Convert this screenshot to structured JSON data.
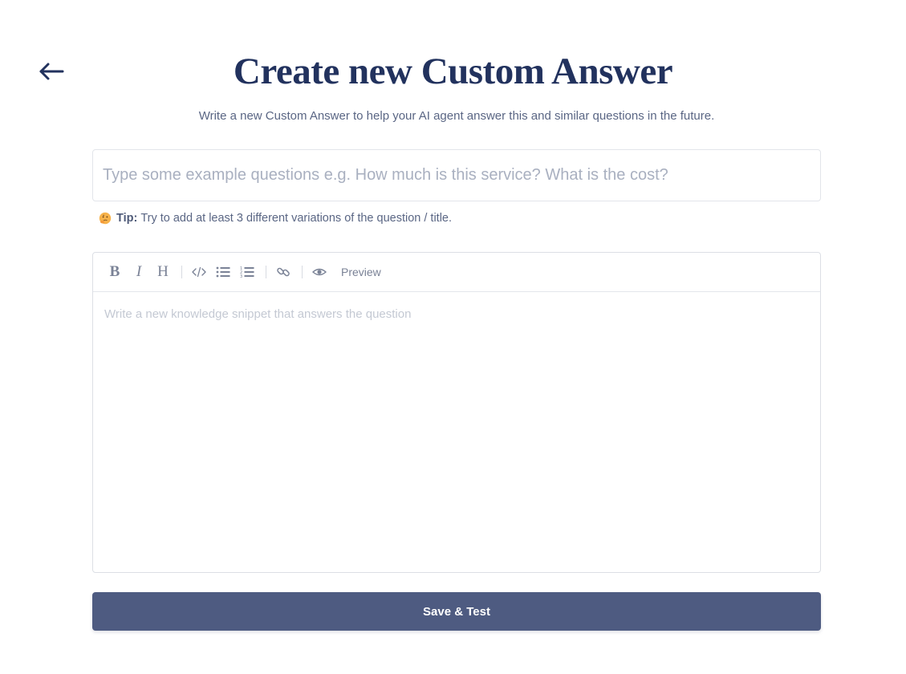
{
  "header": {
    "back_icon": "arrow-left-icon",
    "title": "Create new Custom Answer",
    "subtitle": "Write a new Custom Answer to help your AI agent answer this and similar questions in the future."
  },
  "question": {
    "placeholder": "Type some example questions e.g. How much is this service? What is the cost?",
    "value": ""
  },
  "tip": {
    "icon": "thinking-face-emoji",
    "label": "Tip:",
    "text": "Try to add at least 3 different variations of the question / title."
  },
  "editor": {
    "toolbar": {
      "bold": "B",
      "italic": "I",
      "heading": "H",
      "code_icon": "code-icon",
      "bullet_list_icon": "bullet-list-icon",
      "numbered_list_icon": "numbered-list-icon",
      "link_icon": "link-icon",
      "preview_icon": "eye-icon",
      "preview_label": "Preview"
    },
    "placeholder": "Write a new knowledge snippet that answers the question",
    "value": ""
  },
  "actions": {
    "save_label": "Save & Test"
  },
  "colors": {
    "title": "#22325e",
    "primary_button": "#4e5b81",
    "muted_text": "#5a6684",
    "placeholder": "#a9b0c0"
  }
}
